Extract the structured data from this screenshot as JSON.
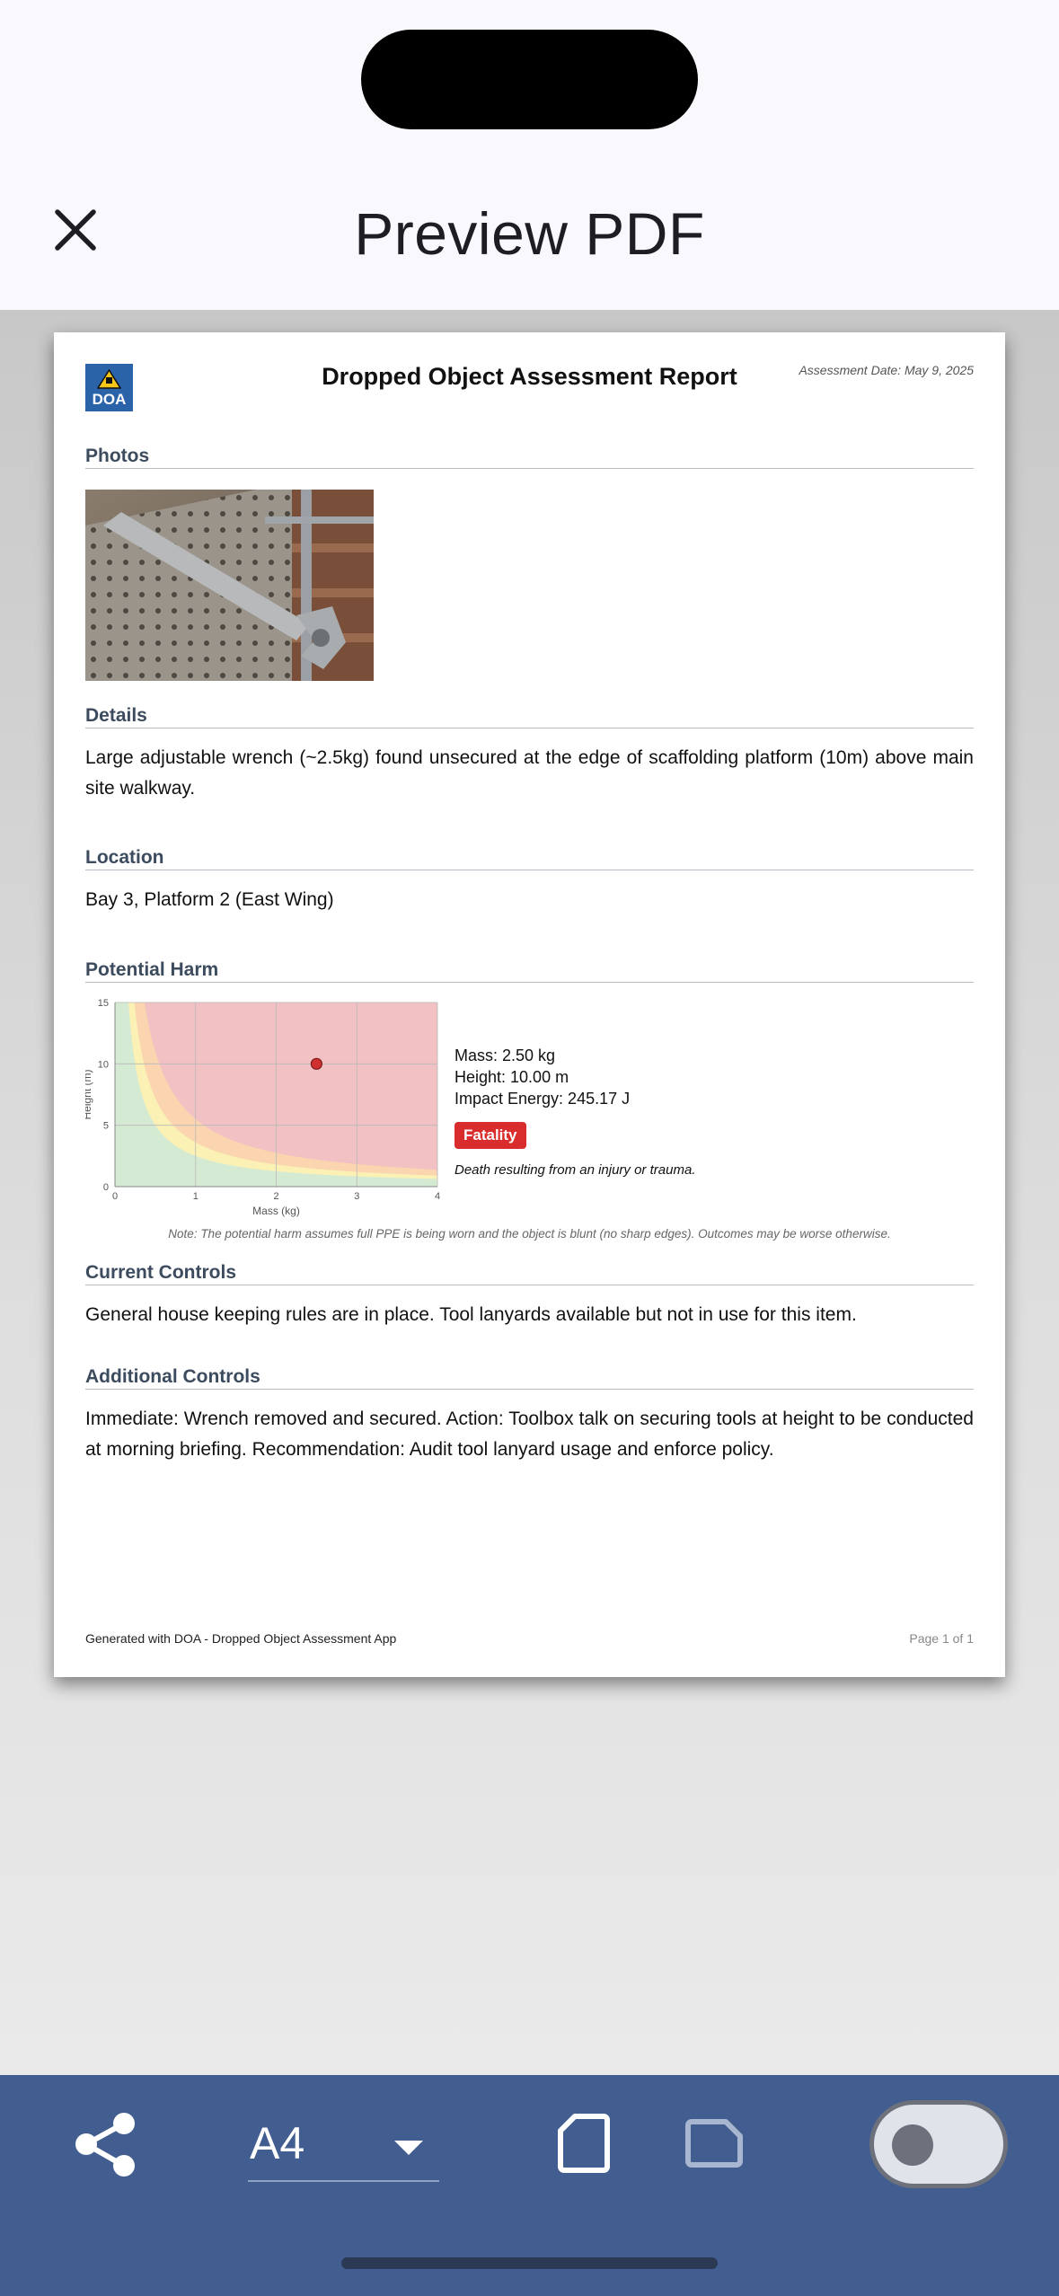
{
  "header": {
    "title": "Preview PDF"
  },
  "report": {
    "logo_text": "DOA",
    "title": "Dropped Object Assessment Report",
    "assessment_date": "Assessment Date: May 9, 2025",
    "sections": {
      "photos": "Photos",
      "details": "Details",
      "location": "Location",
      "potential_harm": "Potential Harm",
      "current_controls": "Current Controls",
      "additional_controls": "Additional Controls"
    },
    "details_text": "Large adjustable wrench (~2.5kg) found unsecured at the edge of scaffolding platform (10m) above main site walkway.",
    "location_text": "Bay 3, Platform 2 (East Wing)",
    "harm": {
      "mass": "Mass: 2.50 kg",
      "height": "Height: 10.00 m",
      "energy": "Impact Energy: 245.17 J",
      "badge": "Fatality",
      "badge_color": "#d92d2d",
      "description": "Death resulting from an injury or trauma."
    },
    "note": "Note: The potential harm assumes full PPE is being worn and the object is blunt (no sharp edges). Outcomes may be worse otherwise.",
    "current_controls_text": "General house keeping rules are in place. Tool lanyards available but not in use for this item.",
    "additional_controls_text": "Immediate: Wrench removed and secured. Action: Toolbox talk on securing tools at height to be conducted at morning briefing. Recommendation: Audit tool lanyard usage and enforce policy.",
    "footer_left": "Generated with DOA - Dropped Object Assessment App",
    "footer_right": "Page 1 of 1"
  },
  "chart_data": {
    "type": "scatter",
    "xlabel": "Mass (kg)",
    "ylabel": "Height (m)",
    "xlim": [
      0,
      4
    ],
    "ylim": [
      0,
      15
    ],
    "xticks": [
      "0",
      "1",
      "2",
      "3",
      "4"
    ],
    "yticks": [
      "0",
      "5",
      "10",
      "15"
    ],
    "grid": true,
    "point": {
      "x": 2.5,
      "y": 10
    },
    "zone_colors": [
      "#d5ead3",
      "#fbf1b5",
      "#fbd5b0",
      "#f2c1c3"
    ],
    "point_color": "#d03030"
  },
  "toolbar": {
    "paper_size": "A4",
    "share_icon": "share-icon",
    "portrait_icon": "portrait-page-icon",
    "landscape_icon": "landscape-page-icon",
    "toggle_state": "off"
  }
}
